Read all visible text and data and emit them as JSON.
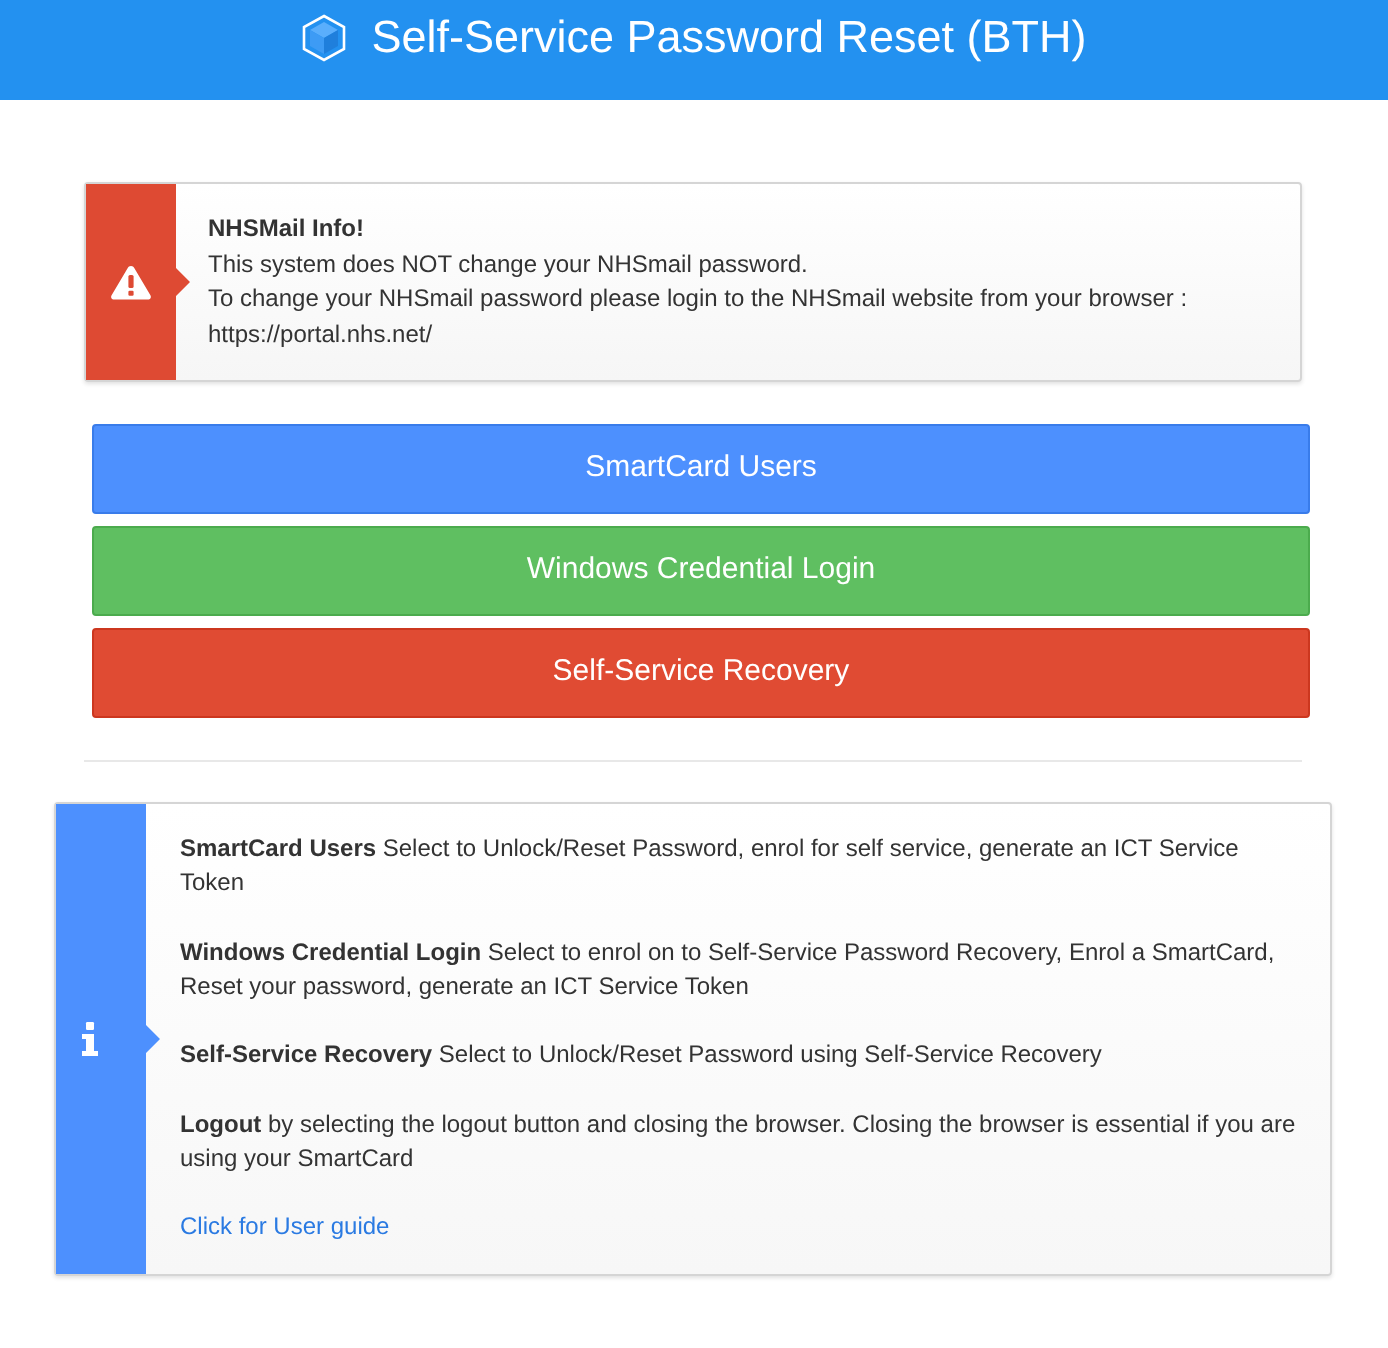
{
  "header": {
    "title": "Self-Service Password Reset (BTH)"
  },
  "alert": {
    "title": "NHSMail Info!",
    "lines": [
      "This system does NOT change your NHSmail password.",
      "To change your NHSmail password please login to the NHSmail website from your browser :",
      "https://portal.nhs.net/"
    ]
  },
  "buttons": [
    {
      "label": "SmartCard Users",
      "color": "#4d90fe"
    },
    {
      "label": "Windows Credential Login",
      "color": "#5fbf61"
    },
    {
      "label": "Self-Service Recovery",
      "color": "#e04b33"
    }
  ],
  "info": {
    "paragraphs": [
      "**SmartCard Users** Select to Unlock/Reset Password, enrol for self service, generate an ICT Service Token",
      "**Windows Credential Login** Select to enrol on to Self-Service Password Recovery, Enrol a SmartCard, Reset your password, generate an ICT Service Token",
      "**Self-Service Recovery** Select to Unlock/Reset Password using Self-Service Recovery",
      "**Logout** by selecting the logout button and closing the browser. Closing the browser is essential if you are using your SmartCard"
    ],
    "link": "Click for User guide"
  }
}
